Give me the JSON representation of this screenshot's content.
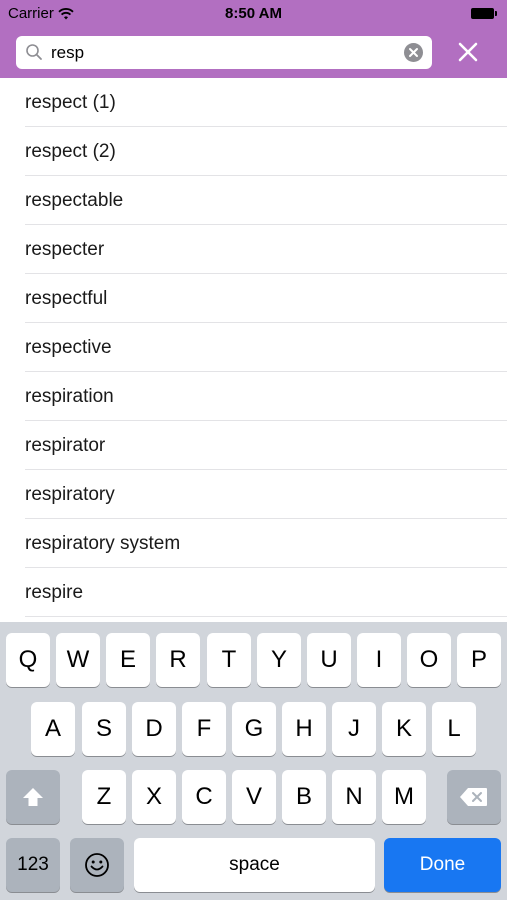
{
  "status_bar": {
    "carrier": "Carrier",
    "time": "8:50 AM"
  },
  "search": {
    "query": "resp"
  },
  "results": [
    "respect (1)",
    "respect (2)",
    "respectable",
    "respecter",
    "respectful",
    "respective",
    "respiration",
    "respirator",
    "respiratory",
    "respiratory system",
    "respire"
  ],
  "keyboard": {
    "row1": [
      "Q",
      "W",
      "E",
      "R",
      "T",
      "Y",
      "U",
      "I",
      "O",
      "P"
    ],
    "row2": [
      "A",
      "S",
      "D",
      "F",
      "G",
      "H",
      "J",
      "K",
      "L"
    ],
    "row3": [
      "Z",
      "X",
      "C",
      "V",
      "B",
      "N",
      "M"
    ],
    "numbers_key": "123",
    "space_key": "space",
    "done_key": "Done"
  },
  "colors": {
    "accent": "#b26fc1",
    "done": "#1877f2",
    "keyboard_bg": "#d1d5db"
  },
  "icons": [
    "wifi-icon",
    "battery-icon",
    "search-icon",
    "clear-icon",
    "close-icon",
    "shift-icon",
    "delete-icon",
    "emoji-icon"
  ]
}
